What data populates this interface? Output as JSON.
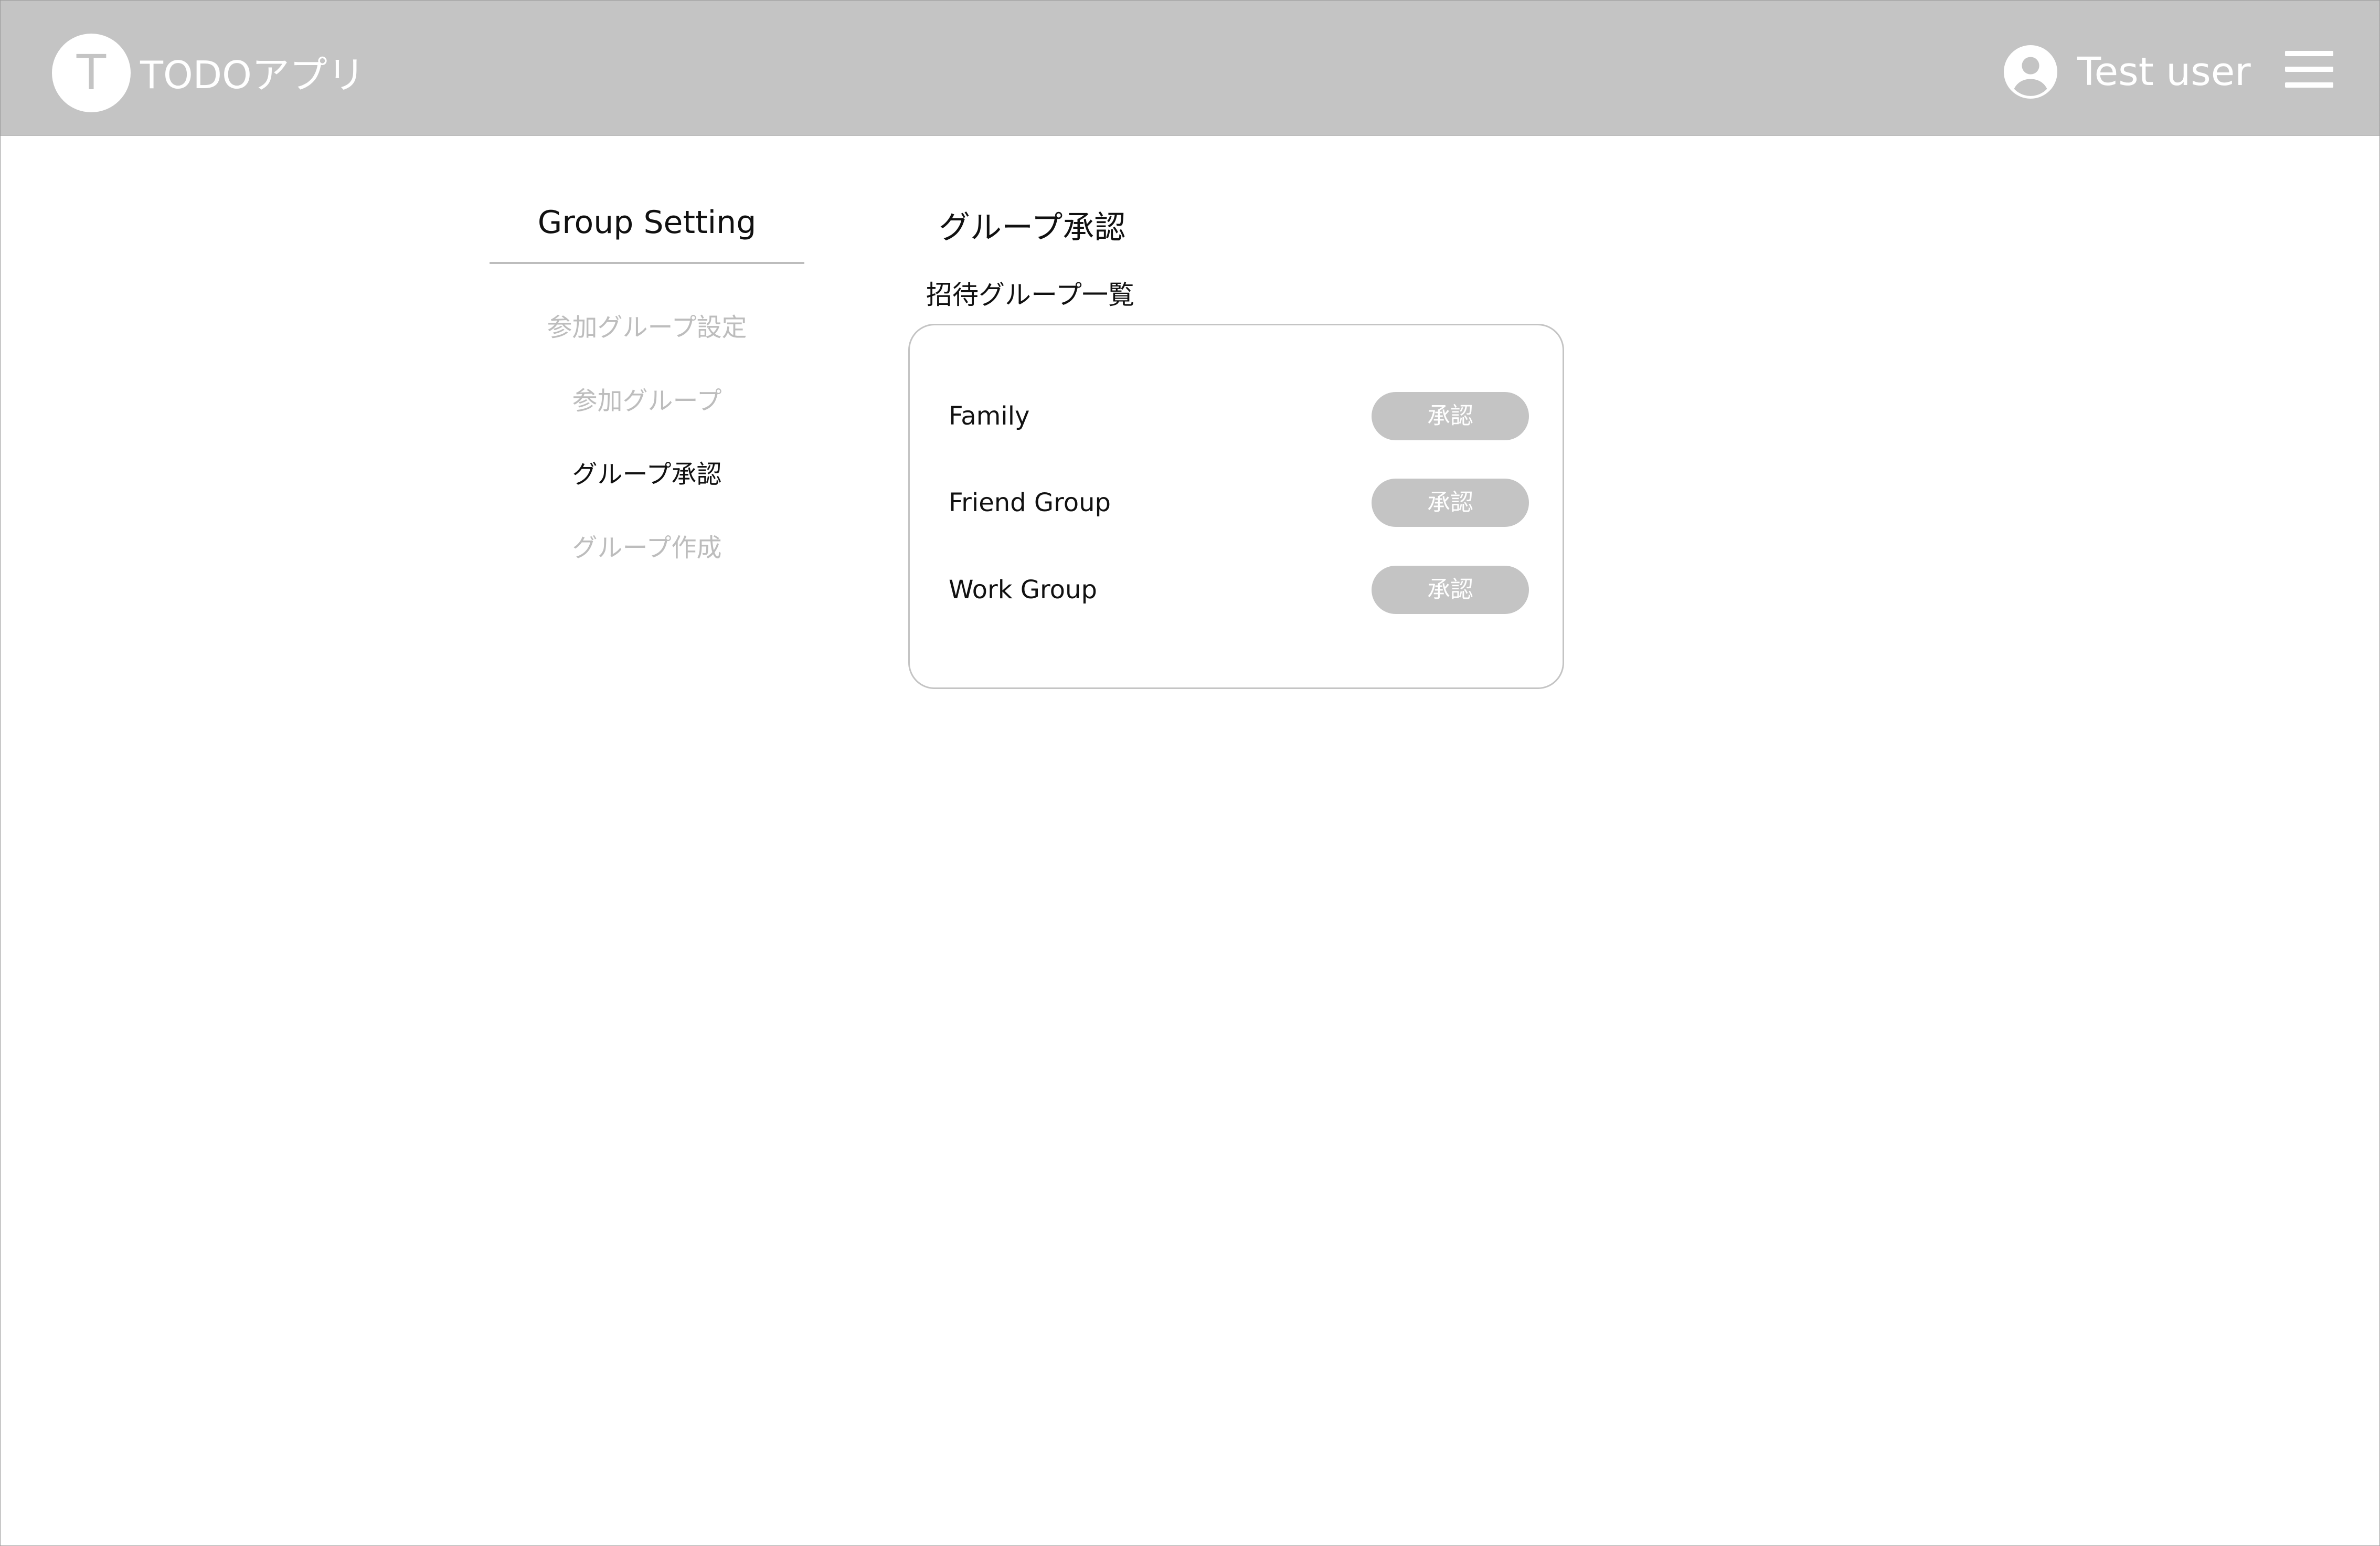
{
  "header": {
    "logo_letter": "T",
    "app_title": "TODOアプリ",
    "user_name": "Test user",
    "user_icon": "account-circle-icon",
    "menu_icon": "hamburger-menu-icon",
    "background_color": "#c4c4c4"
  },
  "sidebar": {
    "title": "Group Setting",
    "items": [
      {
        "label": "参加グループ設定",
        "active": false
      },
      {
        "label": "参加グループ",
        "active": false
      },
      {
        "label": "グループ承認",
        "active": true
      },
      {
        "label": "グループ作成",
        "active": false
      }
    ]
  },
  "main": {
    "title": "グループ承認",
    "section_label": "招待グループ一覧",
    "groups": [
      {
        "name": "Family",
        "button_label": "承認"
      },
      {
        "name": "Friend Group",
        "button_label": "承認"
      },
      {
        "name": "Work Group",
        "button_label": "承認"
      }
    ]
  }
}
